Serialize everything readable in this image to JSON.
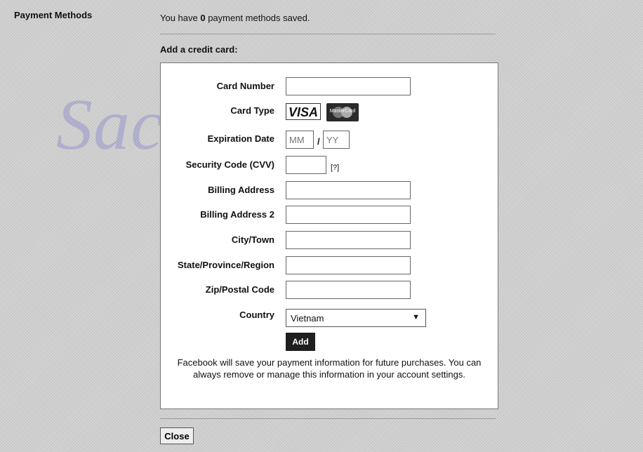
{
  "watermark": "Sachvui.Com",
  "section_title": "Payment Methods",
  "status": {
    "prefix": "You have ",
    "count": "0",
    "suffix": " payment methods saved."
  },
  "form_heading": "Add a credit card:",
  "fields": {
    "card_number": "Card Number",
    "card_type": "Card Type",
    "expiration_date": "Expiration Date",
    "security_code": "Security Code (CVV)",
    "billing_address": "Billing Address",
    "billing_address_2": "Billing Address 2",
    "city_town": "City/Town",
    "state_region": "State/Province/Region",
    "zip_code": "Zip/Postal Code",
    "country": "Country"
  },
  "card_types": {
    "visa": "VISA",
    "mastercard": "MasterCard"
  },
  "expiration": {
    "month_placeholder": "MM",
    "year_placeholder": "YY",
    "separator": "/"
  },
  "cvv_help": "[?]",
  "country_selected": "Vietnam",
  "add_label": "Add",
  "info_text": "Facebook will save your payment information for future purchases. You can always remove or manage this information in your account settings.",
  "close_label": "Close"
}
